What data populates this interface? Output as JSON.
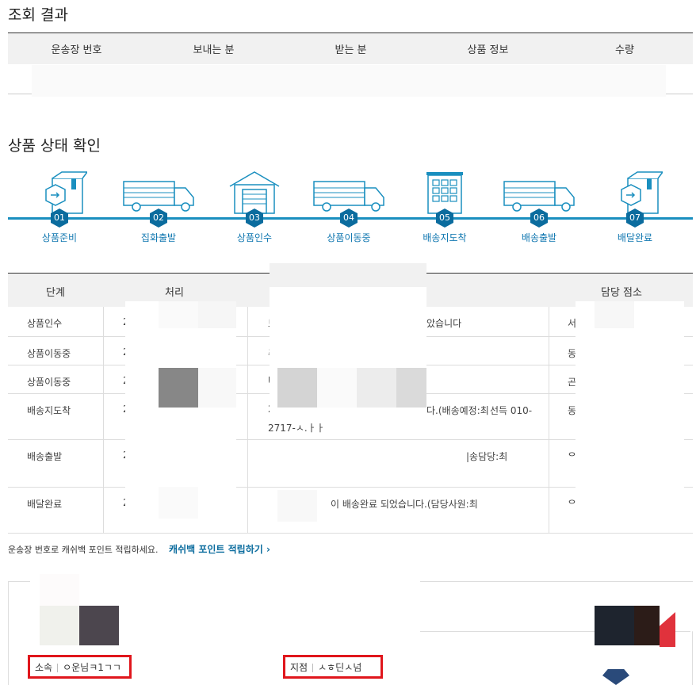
{
  "result": {
    "title": "조회 결과",
    "columns": [
      "운송장 번호",
      "보내는 분",
      "받는 분",
      "상품 정보",
      "수량"
    ]
  },
  "status": {
    "title": "상품 상태 확인",
    "steps": [
      {
        "num": "01",
        "label": "상품준비",
        "icon": "box-icon"
      },
      {
        "num": "02",
        "label": "집화출발",
        "icon": "truck-icon"
      },
      {
        "num": "03",
        "label": "상품인수",
        "icon": "warehouse-icon"
      },
      {
        "num": "04",
        "label": "상품이동중",
        "icon": "truck-icon"
      },
      {
        "num": "05",
        "label": "배송지도착",
        "icon": "building-icon"
      },
      {
        "num": "06",
        "label": "배송출발",
        "icon": "truck-icon"
      },
      {
        "num": "07",
        "label": "배달완료",
        "icon": "box-icon"
      }
    ]
  },
  "detail": {
    "headers": {
      "stage": "단계",
      "process": "처리",
      "office": "담당 점소"
    },
    "rows": [
      {
        "stage": "상품인수",
        "c2": "2",
        "c3": "보",
        "c3b": "았습니다",
        "c4": "서"
      },
      {
        "stage": "상품이동중",
        "c2": "2",
        "c3": "주",
        "c3b": "",
        "c4": "동"
      },
      {
        "stage": "상품이동중",
        "c2": "2",
        "c3": "U",
        "c3b": "",
        "c4": "곤"
      },
      {
        "stage": "배송지도착",
        "c2": "2",
        "c3": "2",
        "c3b": "다.(배송예정:최",
        "c3c": "선득 010-",
        "c3d": "2717-ㅅ.ㅏㅏ",
        "c4": "동"
      },
      {
        "stage": "배송출발",
        "c2": "2",
        "c3": "",
        "c3b": "|송담당:최",
        "c4": "ᄋ"
      },
      {
        "stage": "배달완료",
        "c2": "2",
        "c3": "",
        "c3b": "이 배송완료 되었습니다.(담당사원:최",
        "c4": "ᄋ"
      }
    ]
  },
  "cashback": {
    "text": "운송장 번호로 캐쉬백 포인트 적립하세요.",
    "link": "캐쉬백 포인트 적립하기 ›"
  },
  "card": {
    "affiliation_label": "소속",
    "affiliation_value": "ㅇ운님ㅋ1ㄱㄱ",
    "branch_label": "지점",
    "branch_value": "ㅅㅎ딘ㅅ넘"
  },
  "colors": {
    "accent": "#1a8fbf",
    "step_badge": "#0b6c9e",
    "highlight": "#e0161c"
  }
}
